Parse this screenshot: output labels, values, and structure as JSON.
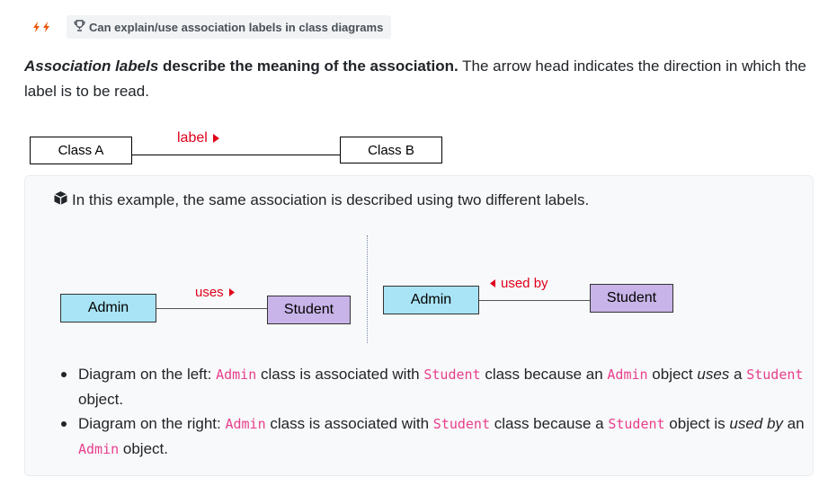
{
  "badge": {
    "bolt_icons": [
      "lightning-bolt-icon",
      "lightning-bolt-icon"
    ],
    "trophy_icon": "trophy-icon",
    "text": "Can explain/use association labels in class diagrams"
  },
  "intro": {
    "term": "Association labels",
    "bold_rest": " describe the meaning of the association.",
    "normal": " The arrow head indicates the direction in which the label is to be read."
  },
  "top_diagram": {
    "class_a": "Class A",
    "class_b": "Class B",
    "label": "label",
    "arrow": "right"
  },
  "example": {
    "icon": "box-icon",
    "heading": "In this example, the same association is described using two different labels.",
    "left": {
      "class_1": "Admin",
      "class_2": "Student",
      "label": "uses",
      "arrow": "right"
    },
    "right": {
      "class_1": "Admin",
      "class_2": "Student",
      "label": "used by",
      "arrow": "left"
    }
  },
  "bullets": [
    {
      "p1": "Diagram on the left: ",
      "c1": "Admin",
      "p2": " class is associated with ",
      "c2": "Student",
      "p3": " class because an ",
      "c3": "Admin",
      "p4": " object ",
      "em": "uses",
      "p5": " a ",
      "c4": "Student",
      "p6": " object."
    },
    {
      "p1": "Diagram on the right: ",
      "c1": "Admin",
      "p2": " class is associated with ",
      "c2": "Student",
      "p3": " class because a ",
      "c3": "Student",
      "p4": " object is ",
      "em": "used by",
      "p5": " an ",
      "c4": "Admin",
      "p6": " object."
    }
  ],
  "colors": {
    "label_red": "#e0001b",
    "code_pink": "#e83e8c",
    "admin_blue": "#a8e4f5",
    "student_purple": "#c8b4e8",
    "bolt_orange": "#e8590c"
  }
}
